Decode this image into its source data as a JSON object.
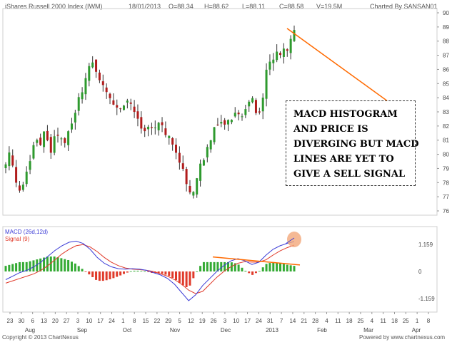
{
  "header": {
    "symbol": "iShares Russell 2000 Index (IWM)",
    "date": "18/01/2013",
    "open": "O=88.34",
    "high": "H=88.62",
    "low": "L=88.11",
    "close": "C=88.58",
    "volume": "V=19.5M",
    "charted_by": "Charted By SANSAN01"
  },
  "footer": {
    "copyright": "Copyright © 2013 ChartNexus",
    "powered": "Powered by www.chartnexus.com"
  },
  "annotation": {
    "lines": [
      "MACD HISTOGRAM",
      "AND PRICE IS",
      "DIVERGING BUT MACD",
      "LINES ARE YET TO",
      "GIVE A SELL SIGNAL"
    ]
  },
  "colors": {
    "up": "#2e9a2e",
    "down": "#b01c1c",
    "macd": "#3b3bd6",
    "signal": "#e03a2a",
    "hist_pos": "#33aa33",
    "hist_neg": "#e03a2a",
    "trend": "#ff6a00",
    "highlight": "#f3a77b"
  },
  "chart_data": [
    {
      "type": "candlestick",
      "title": "",
      "ylim": [
        76,
        90
      ],
      "y_ticks": [
        76,
        77,
        78,
        79,
        80,
        81,
        82,
        83,
        84,
        85,
        86,
        87,
        88,
        89,
        90
      ],
      "x_tick_labels": [
        "23",
        "30",
        "6",
        "13",
        "20",
        "27",
        "3",
        "10",
        "17",
        "24",
        "1",
        "8",
        "15",
        "22",
        "29",
        "5",
        "12",
        "19",
        "26",
        "3",
        "10",
        "17",
        "24",
        "31",
        "7",
        "14",
        "21",
        "28",
        "4",
        "11",
        "18",
        "25",
        "4",
        "11",
        "18",
        "25",
        "1",
        "8"
      ],
      "month_labels": [
        "Aug",
        "Sep",
        "Oct",
        "Nov",
        "Dec",
        "2013",
        "Feb",
        "Mar",
        "Apr"
      ],
      "close_path": [
        79.2,
        80.1,
        79.0,
        78.2,
        77.3,
        77.6,
        78.6,
        79.5,
        80.3,
        81.2,
        80.8,
        81.5,
        81.0,
        80.1,
        80.9,
        81.6,
        81.1,
        80.5,
        81.3,
        82.0,
        82.6,
        83.8,
        84.2,
        85.4,
        85.9,
        86.6,
        86.1,
        85.6,
        85.2,
        84.7,
        84.1,
        83.2,
        83.6,
        83.0,
        82.9,
        83.6,
        84.0,
        83.1,
        82.6,
        82.2,
        82.0,
        81.6,
        82.1,
        81.4,
        82.3,
        82.5,
        81.8,
        81.4,
        81.0,
        80.4,
        80.0,
        79.4,
        78.6,
        77.3,
        77.0,
        77.6,
        78.7,
        79.4,
        79.9,
        80.6,
        81.4,
        81.8,
        82.2,
        82.6,
        82.0,
        82.3,
        82.6,
        83.2,
        83.0,
        82.9,
        83.4,
        84.0,
        83.7,
        83.1,
        82.6,
        84.0,
        86.0,
        86.4,
        86.7,
        87.0,
        86.8,
        87.5,
        87.6,
        88.3,
        88.58
      ],
      "trendline": {
        "from": [
          19,
          82.5
        ],
        "to": [
          72,
          88.9
        ]
      }
    },
    {
      "type": "macd",
      "title": "",
      "legend": [
        "MACD (26d,12d)",
        "Signal (9)"
      ],
      "ylim": [
        -1.159,
        1.159
      ],
      "y_ticks": [
        1.159,
        0,
        -1.159
      ],
      "macd_line": [
        -0.35,
        -0.2,
        -0.05,
        0.05,
        0.2,
        0.4,
        0.65,
        0.9,
        1.1,
        1.25,
        1.3,
        1.2,
        0.95,
        0.6,
        0.35,
        0.2,
        0.12,
        0.1,
        0.12,
        0.1,
        0.05,
        -0.05,
        -0.15,
        -0.3,
        -0.55,
        -0.9,
        -1.25,
        -1.0,
        -0.6,
        -0.3,
        0.0,
        0.25,
        0.45,
        0.55,
        0.45,
        0.3,
        0.4,
        0.7,
        0.95,
        1.1,
        1.2,
        1.28
      ],
      "signal_line": [
        -0.5,
        -0.4,
        -0.3,
        -0.2,
        -0.1,
        0.05,
        0.25,
        0.5,
        0.75,
        0.95,
        1.1,
        1.15,
        1.05,
        0.85,
        0.6,
        0.4,
        0.25,
        0.15,
        0.1,
        0.08,
        0.05,
        0.0,
        -0.1,
        -0.2,
        -0.35,
        -0.55,
        -0.8,
        -0.95,
        -0.85,
        -0.55,
        -0.25,
        0.0,
        0.2,
        0.35,
        0.42,
        0.4,
        0.4,
        0.5,
        0.7,
        0.88,
        1.02,
        1.13
      ],
      "histogram_trend": {
        "from": [
          29,
          0.62
        ],
        "to": [
          41,
          0.28
        ]
      }
    }
  ]
}
